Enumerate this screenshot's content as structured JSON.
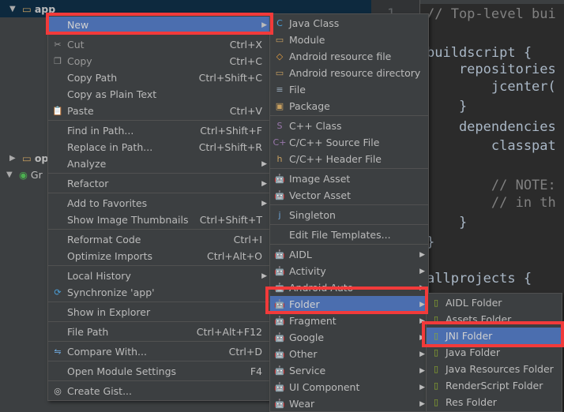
{
  "tree": {
    "root": "app",
    "items": [
      "op",
      "Gr"
    ]
  },
  "editor": {
    "line_number": "1",
    "lines": [
      {
        "t": "// Top-level bui",
        "c": true
      },
      {
        "t": ""
      },
      {
        "t": "buildscript {"
      },
      {
        "t": "    repositories"
      },
      {
        "t": "        jcenter("
      },
      {
        "t": "    }"
      },
      {
        "t": "    dependencies"
      },
      {
        "t": "        classpat"
      },
      {
        "t": ""
      },
      {
        "t": "        // NOTE:",
        "c": true
      },
      {
        "t": "        // in th",
        "c": true
      },
      {
        "t": "    }"
      },
      {
        "t": "}"
      },
      {
        "t": ""
      },
      {
        "t": "allprojects {"
      }
    ]
  },
  "context_menu": {
    "items": [
      {
        "label": "New",
        "arrow": true,
        "highlight": true
      },
      "sep",
      {
        "label": "Cut",
        "shortcut": "Ctrl+X",
        "icon": "scissors",
        "disabled": true
      },
      {
        "label": "Copy",
        "shortcut": "Ctrl+C",
        "icon": "copy",
        "disabled": true
      },
      {
        "label": "Copy Path",
        "shortcut": "Ctrl+Shift+C"
      },
      {
        "label": "Copy as Plain Text"
      },
      {
        "label": "Paste",
        "shortcut": "Ctrl+V",
        "icon": "paste"
      },
      "sep",
      {
        "label": "Find in Path...",
        "shortcut": "Ctrl+Shift+F"
      },
      {
        "label": "Replace in Path...",
        "shortcut": "Ctrl+Shift+R"
      },
      {
        "label": "Analyze",
        "arrow": true
      },
      "sep",
      {
        "label": "Refactor",
        "arrow": true
      },
      "sep",
      {
        "label": "Add to Favorites",
        "arrow": true
      },
      {
        "label": "Show Image Thumbnails",
        "shortcut": "Ctrl+Shift+T"
      },
      "sep",
      {
        "label": "Reformat Code",
        "shortcut": "Ctrl+I"
      },
      {
        "label": "Optimize Imports",
        "shortcut": "Ctrl+Alt+O"
      },
      "sep",
      {
        "label": "Local History",
        "arrow": true
      },
      {
        "label": "Synchronize 'app'",
        "icon": "sync"
      },
      "sep",
      {
        "label": "Show in Explorer"
      },
      "sep",
      {
        "label": "File Path",
        "shortcut": "Ctrl+Alt+F12"
      },
      "sep",
      {
        "label": "Compare With...",
        "shortcut": "Ctrl+D",
        "icon": "compare"
      },
      "sep",
      {
        "label": "Open Module Settings",
        "shortcut": "F4"
      },
      "sep",
      {
        "label": "Create Gist...",
        "icon": "github"
      }
    ]
  },
  "new_submenu": {
    "items": [
      {
        "label": "Java Class",
        "icon": "java-class"
      },
      {
        "label": "Module",
        "icon": "module"
      },
      {
        "label": "Android resource file",
        "icon": "resource-file"
      },
      {
        "label": "Android resource directory",
        "icon": "folder"
      },
      {
        "label": "File",
        "icon": "file"
      },
      {
        "label": "Package",
        "icon": "package"
      },
      "sep",
      {
        "label": "C++ Class",
        "icon": "cpp-class"
      },
      {
        "label": "C/C++ Source File",
        "icon": "cpp-source"
      },
      {
        "label": "C/C++ Header File",
        "icon": "cpp-header"
      },
      "sep",
      {
        "label": "Image Asset",
        "icon": "android"
      },
      {
        "label": "Vector Asset",
        "icon": "android"
      },
      "sep",
      {
        "label": "Singleton",
        "icon": "singleton"
      },
      "sep",
      {
        "label": "Edit File Templates..."
      },
      "sep",
      {
        "label": "AIDL",
        "icon": "android",
        "arrow": true
      },
      {
        "label": "Activity",
        "icon": "android",
        "arrow": true
      },
      {
        "label": "Android Auto",
        "icon": "android",
        "arrow": true
      },
      {
        "label": "Folder",
        "icon": "android",
        "arrow": true,
        "highlight": true
      },
      {
        "label": "Fragment",
        "icon": "android",
        "arrow": true
      },
      {
        "label": "Google",
        "icon": "android",
        "arrow": true
      },
      {
        "label": "Other",
        "icon": "android",
        "arrow": true
      },
      {
        "label": "Service",
        "icon": "android",
        "arrow": true
      },
      {
        "label": "UI Component",
        "icon": "android",
        "arrow": true
      },
      {
        "label": "Wear",
        "icon": "android",
        "arrow": true
      }
    ]
  },
  "folder_submenu": {
    "items": [
      {
        "label": "AIDL Folder",
        "icon": "android-folder"
      },
      {
        "label": "Assets Folder",
        "icon": "android-folder"
      },
      {
        "label": "JNI Folder",
        "icon": "android-folder",
        "highlight": true
      },
      {
        "label": "Java Folder",
        "icon": "android-folder"
      },
      {
        "label": "Java Resources Folder",
        "icon": "android-folder"
      },
      {
        "label": "RenderScript Folder",
        "icon": "android-folder"
      },
      {
        "label": "Res Folder",
        "icon": "android-folder"
      }
    ]
  },
  "colors": {
    "highlight": "#4b6eaf",
    "annotation": "#f23a3a",
    "android": "#8dab2d"
  }
}
